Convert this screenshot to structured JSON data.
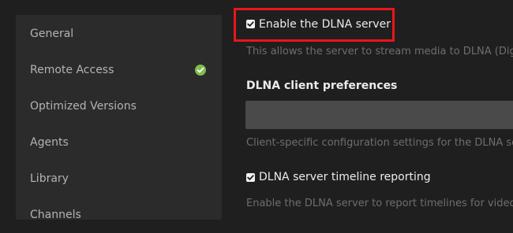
{
  "sidebar": {
    "items": [
      {
        "label": "General"
      },
      {
        "label": "Remote Access",
        "status_icon": "check-circle-icon",
        "status_color": "#7fbf4f"
      },
      {
        "label": "Optimized Versions"
      },
      {
        "label": "Agents"
      },
      {
        "label": "Library"
      },
      {
        "label": "Channels"
      }
    ]
  },
  "settings": {
    "enable_dlna": {
      "label": "Enable the DLNA server",
      "checked": true,
      "description": "This allows the server to stream media to DLNA (Digi"
    },
    "client_prefs": {
      "title": "DLNA client preferences",
      "value": "",
      "description": "Client-specific configuration settings for the DLNA se"
    },
    "timeline_reporting": {
      "label": "DLNA server timeline reporting",
      "checked": true,
      "description": "Enable the DLNA server to report timelines for video"
    }
  },
  "colors": {
    "background": "#1f1f1f",
    "sidebar": "#2b2b2b",
    "highlight": "#e8161b",
    "accent_green": "#7fbf4f"
  }
}
